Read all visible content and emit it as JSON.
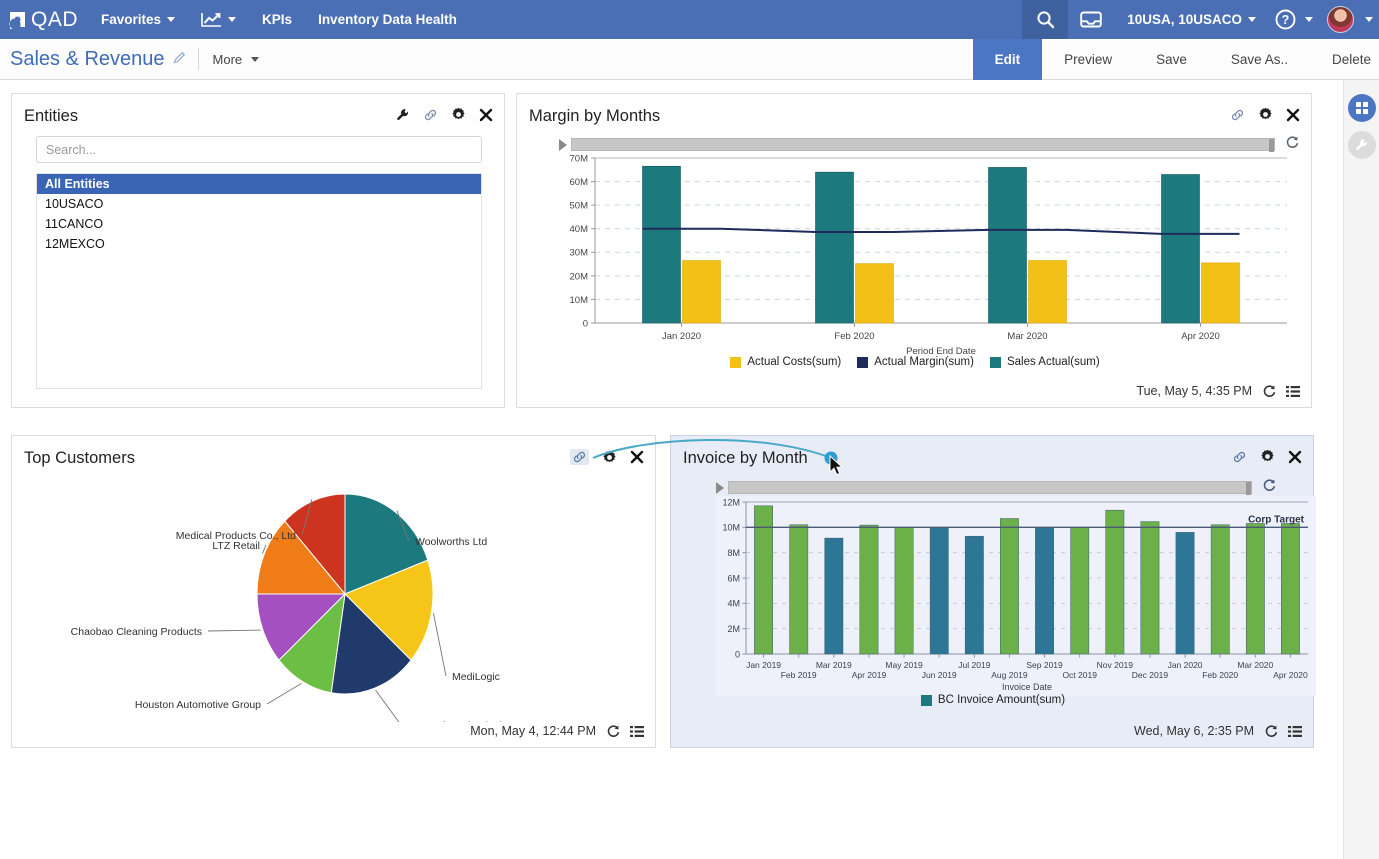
{
  "topnav": {
    "logo_text": "QAD",
    "items": [
      {
        "label": "Favorites",
        "icon": "caret-down-icon",
        "has_caret": true
      },
      {
        "label": "",
        "icon": "analytics-chart-icon",
        "has_caret": true
      },
      {
        "label": "KPIs",
        "icon": "",
        "has_caret": false
      },
      {
        "label": "Inventory Data Health",
        "icon": "",
        "has_caret": false
      }
    ],
    "search_icon": "search-icon",
    "inbox_icon": "inbox-tray-icon",
    "entity_selector": "10USA, 10USACO",
    "help_icon": "question-mark-icon",
    "avatar_icon": "user-avatar"
  },
  "subbar": {
    "title": "Sales & Revenue",
    "edit_pencil_icon": "pencil-icon",
    "more_label": "More",
    "actions": [
      {
        "label": "Edit",
        "primary": true
      },
      {
        "label": "Preview",
        "primary": false
      },
      {
        "label": "Save",
        "primary": false
      },
      {
        "label": "Save As..",
        "primary": false
      },
      {
        "label": "Delete",
        "primary": false
      }
    ]
  },
  "rail": {
    "buttons": [
      {
        "name": "widgets-grid-button",
        "icon": "grid-icon",
        "style": "blue"
      },
      {
        "name": "tools-wrench-button",
        "icon": "wrench-icon",
        "style": "gray"
      }
    ]
  },
  "entities": {
    "title": "Entities",
    "tools": [
      "wrench-icon",
      "link-icon",
      "gear-icon",
      "close-icon"
    ],
    "search_placeholder": "Search...",
    "items": [
      {
        "label": "All Entities",
        "selected": true
      },
      {
        "label": "10USACO",
        "selected": false
      },
      {
        "label": "11CANCO",
        "selected": false
      },
      {
        "label": "12MEXCO",
        "selected": false
      }
    ]
  },
  "margin_card": {
    "title": "Margin by Months",
    "tools": [
      "link-icon",
      "gear-icon",
      "close-icon"
    ],
    "refresh_icon": "refresh-icon",
    "timestamp": "Tue, May 5, 4:35 PM",
    "footer_refresh_icon": "refresh-icon",
    "footer_menu_icon": "list-menu-icon"
  },
  "top_customers": {
    "title": "Top Customers",
    "tools": [
      "link-icon",
      "gear-icon",
      "close-icon"
    ],
    "timestamp": "Mon, May 4, 12:44 PM",
    "footer_refresh_icon": "refresh-icon",
    "footer_menu_icon": "list-menu-icon"
  },
  "invoice_card": {
    "title": "Invoice by Month",
    "tools": [
      "link-icon",
      "gear-icon",
      "close-icon"
    ],
    "refresh_icon": "refresh-icon",
    "timestamp": "Wed, May 6, 2:35 PM",
    "footer_refresh_icon": "refresh-icon",
    "footer_menu_icon": "list-menu-icon"
  },
  "colors": {
    "nav_blue": "#4a6fb5",
    "accent_blue": "#4a76c4",
    "teal": "#1c7a7e",
    "yellow": "#f2c017",
    "navy": "#1f2b5b",
    "green": "#6cb04a",
    "steel_blue": "#2e7695",
    "orange": "#ef7c16",
    "purple": "#a450c0",
    "red": "#cc3420",
    "light_green": "#6cbe45"
  },
  "chart_data": [
    {
      "id": "margin-by-months",
      "type": "bar",
      "title": "Margin by Months",
      "xlabel": "Period End Date",
      "ylabel": "",
      "categories": [
        "Jan 2020",
        "Feb 2020",
        "Mar 2020",
        "Apr 2020"
      ],
      "ylim": [
        0,
        70000000
      ],
      "ytick_labels": [
        "0",
        "10M",
        "20M",
        "30M",
        "40M",
        "50M",
        "60M",
        "70M"
      ],
      "ytick_values": [
        0,
        10000000,
        20000000,
        30000000,
        40000000,
        50000000,
        60000000,
        70000000
      ],
      "grid": true,
      "legend_position": "bottom",
      "series": [
        {
          "name": "Sales Actual(sum)",
          "color": "#1c7a7e",
          "kind": "bar",
          "values": [
            66500000,
            64000000,
            66000000,
            63000000
          ]
        },
        {
          "name": "Actual Costs(sum)",
          "color": "#f2c017",
          "kind": "bar",
          "values": [
            26500000,
            25200000,
            26500000,
            25500000
          ]
        },
        {
          "name": "Actual Margin(sum)",
          "color": "#1f2b5b",
          "kind": "line",
          "values": [
            40000000,
            38600000,
            39500000,
            37800000
          ]
        }
      ],
      "legend_order": [
        "Actual Costs(sum)",
        "Actual Margin(sum)",
        "Sales Actual(sum)"
      ]
    },
    {
      "id": "top-customers",
      "type": "pie",
      "title": "Top Customers",
      "slices": [
        {
          "label": "Woolworths Ltd",
          "value": 19.5,
          "color": "#1c7a7e"
        },
        {
          "label": "MediLogic",
          "value": 17.0,
          "color": "#f5c518"
        },
        {
          "label": "Cryocath Technologies Inc.",
          "value": 16.0,
          "color": "#1f3a6b"
        },
        {
          "label": "Houston Automotive Group",
          "value": 11.0,
          "color": "#6cbe45"
        },
        {
          "label": "Chaobao Cleaning Products",
          "value": 11.5,
          "color": "#a450c0"
        },
        {
          "label": "LTZ Retail",
          "value": 13.0,
          "color": "#ef7c16"
        },
        {
          "label": "Medical Products Co., Ltd",
          "value": 12.0,
          "color": "#cc3420"
        }
      ]
    },
    {
      "id": "invoice-by-month",
      "type": "bar",
      "title": "Invoice by Month",
      "xlabel": "Invoice Date",
      "ylabel": "",
      "categories": [
        "Jan 2019",
        "Feb 2019",
        "Mar 2019",
        "Apr 2019",
        "May 2019",
        "Jun 2019",
        "Jul 2019",
        "Aug 2019",
        "Sep 2019",
        "Oct 2019",
        "Nov 2019",
        "Dec 2019",
        "Jan 2020",
        "Feb 2020",
        "Mar 2020",
        "Apr 2020"
      ],
      "ylim": [
        0,
        12000000
      ],
      "ytick_labels": [
        "0",
        "2M",
        "4M",
        "6M",
        "8M",
        "10M",
        "12M"
      ],
      "ytick_values": [
        0,
        2000000,
        4000000,
        6000000,
        8000000,
        10000000,
        12000000
      ],
      "grid": true,
      "legend_position": "bottom",
      "reference_line": {
        "label": "Corp Target",
        "value": 10000000,
        "color": "#4a5a77"
      },
      "series": [
        {
          "name": "BC Invoice Amount(sum)",
          "color": "#1c7a7e",
          "values": [
            11700000,
            10200000,
            9150000,
            10180000,
            10000000,
            10000000,
            9300000,
            10700000,
            10000000,
            10000000,
            11350000,
            10450000,
            9600000,
            10200000,
            10300000,
            10300000
          ],
          "bar_colors": [
            "#6cb04a",
            "#6cb04a",
            "#2e7695",
            "#6cb04a",
            "#6cb04a",
            "#2e7695",
            "#2e7695",
            "#6cb04a",
            "#2e7695",
            "#6cb04a",
            "#6cb04a",
            "#6cb04a",
            "#2e7695",
            "#6cb04a",
            "#6cb04a",
            "#6cb04a"
          ]
        }
      ]
    }
  ]
}
